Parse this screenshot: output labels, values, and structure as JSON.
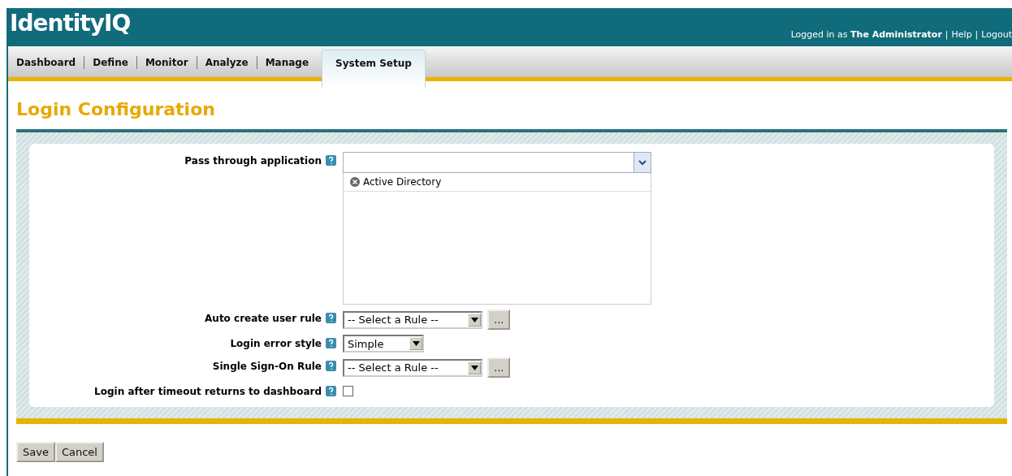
{
  "header": {
    "logo": "IdentityIQ",
    "user_text": "Logged in as **The Administrator**",
    "separator": "|",
    "links": [
      "Help",
      "Logout"
    ]
  },
  "tabs": [
    {
      "label": "Dashboard",
      "selected": false
    },
    {
      "label": "Define",
      "selected": false
    },
    {
      "label": "Monitor",
      "selected": false
    },
    {
      "label": "Analyze",
      "selected": false
    },
    {
      "label": "Manage",
      "selected": false
    },
    {
      "label": "System Setup",
      "selected": true
    }
  ],
  "page_title": "Login Configuration",
  "fields": [
    {
      "kind": "multiselect",
      "label": "Pass through application",
      "items": [
        "Active Directory"
      ]
    },
    {
      "kind": "select_button",
      "label": "Auto create user rule",
      "value": "-- Select a Rule --",
      "button": "..."
    },
    {
      "kind": "select",
      "label": "Login error style",
      "value": "Simple"
    },
    {
      "kind": "select_button",
      "label": "Single Sign-On Rule",
      "value": "-- Select a Rule --",
      "button": "..."
    },
    {
      "kind": "checkbox",
      "label": "Login after timeout returns to dashboard",
      "checked": false
    }
  ],
  "buttons": [
    "Save",
    "Cancel"
  ]
}
